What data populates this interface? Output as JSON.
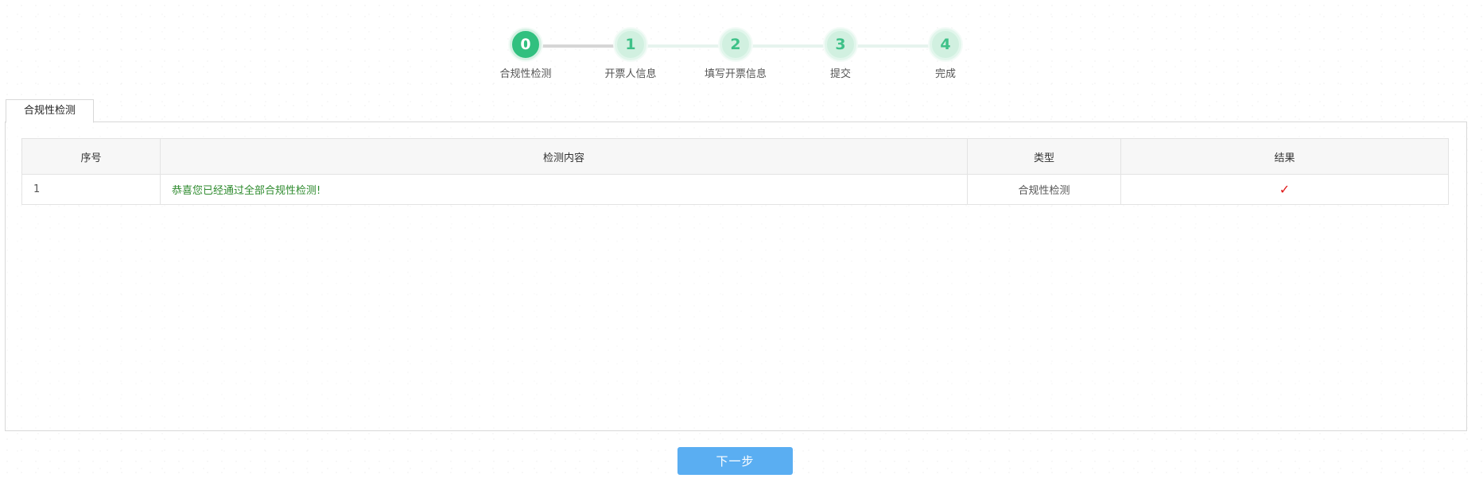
{
  "steps": [
    {
      "number": "0",
      "label": "合规性检测"
    },
    {
      "number": "1",
      "label": "开票人信息"
    },
    {
      "number": "2",
      "label": "填写开票信息"
    },
    {
      "number": "3",
      "label": "提交"
    },
    {
      "number": "4",
      "label": "完成"
    }
  ],
  "current_step": 0,
  "tab": {
    "label": "合规性检测"
  },
  "table": {
    "headers": [
      "序号",
      "检测内容",
      "类型",
      "结果"
    ],
    "rows": [
      {
        "seq": "1",
        "content": "恭喜您已经通过全部合规性检测!",
        "type": "合规性检测",
        "result": "✓"
      }
    ]
  },
  "next_button": {
    "label": "下一步"
  },
  "colors": {
    "step_active": "#31c07f",
    "step_inactive": "#d1f0e0",
    "success_text": "#2d8a2d",
    "check_mark": "#e01818",
    "button": "#5aaef2"
  }
}
